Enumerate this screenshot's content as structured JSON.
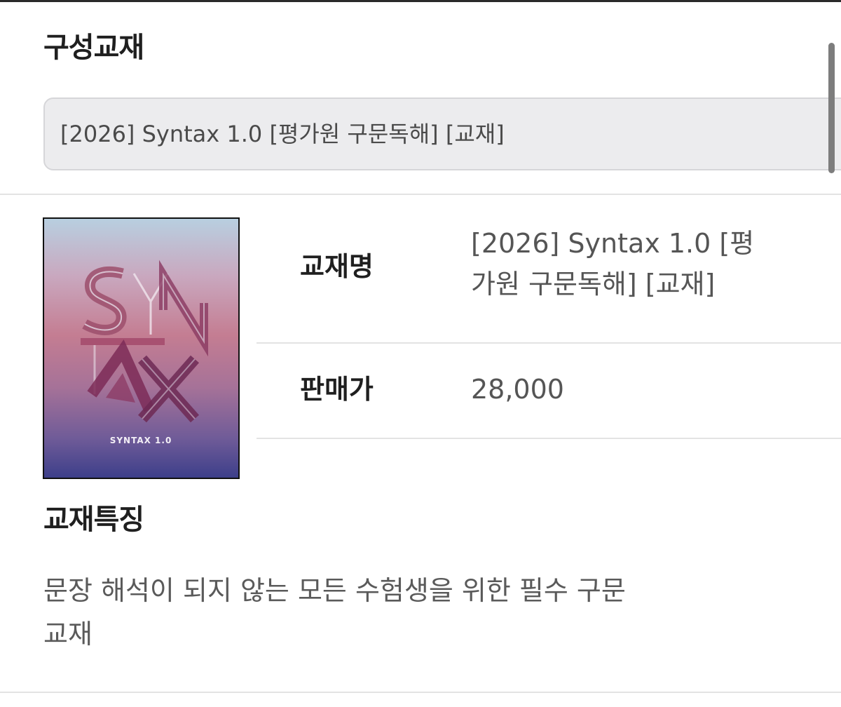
{
  "composition": {
    "title": "구성교재",
    "selected_option": "[2026] Syntax 1.0 [평가원 구문독해] [교재]"
  },
  "book": {
    "cover_title": "SYNTAX 1.0",
    "name_label": "교재명",
    "name_line1": "[2026] Syntax 1.0 [평",
    "name_line2": "가원 구문독해] [교재]",
    "price_label": "판매가",
    "price_value": "28,000"
  },
  "features": {
    "title": "교재특징",
    "description_line1": "문장 해석이 되지 않는 모든 수험생을 위한 필수 구문",
    "description_line2": "교재"
  },
  "colors": {
    "cover_top": "#b8cfe0",
    "cover_mid": "#c47d92",
    "cover_bottom": "#3d3f8a"
  }
}
